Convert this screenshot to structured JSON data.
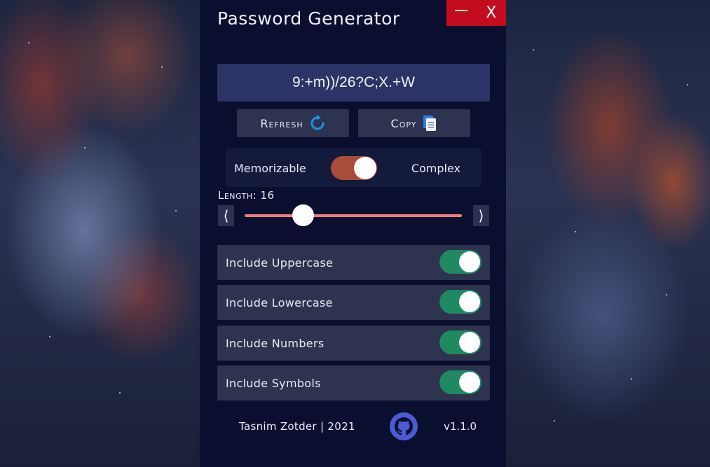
{
  "app": {
    "title": "Password Generator",
    "window_controls": {
      "minimize": "—",
      "close": "X"
    },
    "password": "9:+m))/26?C;X.+W",
    "buttons": {
      "refresh": "Refresh",
      "copy": "Copy"
    },
    "mode": {
      "left_label": "Memorizable",
      "right_label": "Complex",
      "selected": "Complex"
    },
    "length": {
      "label": "Length: 16",
      "value": 16,
      "fraction": 0.27
    },
    "options": [
      {
        "label": "Include Uppercase",
        "checked": true
      },
      {
        "label": "Include Lowercase",
        "checked": true
      },
      {
        "label": "Include Numbers",
        "checked": true
      },
      {
        "label": "Include Symbols",
        "checked": true
      }
    ],
    "footer": {
      "author": "Tasnim Zotder | 2021",
      "version": "v1.1.0"
    },
    "colors": {
      "panel": "#0a0e2f",
      "close_bg": "#c30d1e",
      "toggle_on": "#1f8a62",
      "mode_switch": "#a84e38",
      "slider": "#ef7b79",
      "password_bg": "#2c3366"
    },
    "icons": [
      "minimize-icon",
      "close-icon",
      "refresh-icon",
      "copy-icon",
      "chevron-left-icon",
      "chevron-right-icon",
      "github-icon"
    ]
  }
}
